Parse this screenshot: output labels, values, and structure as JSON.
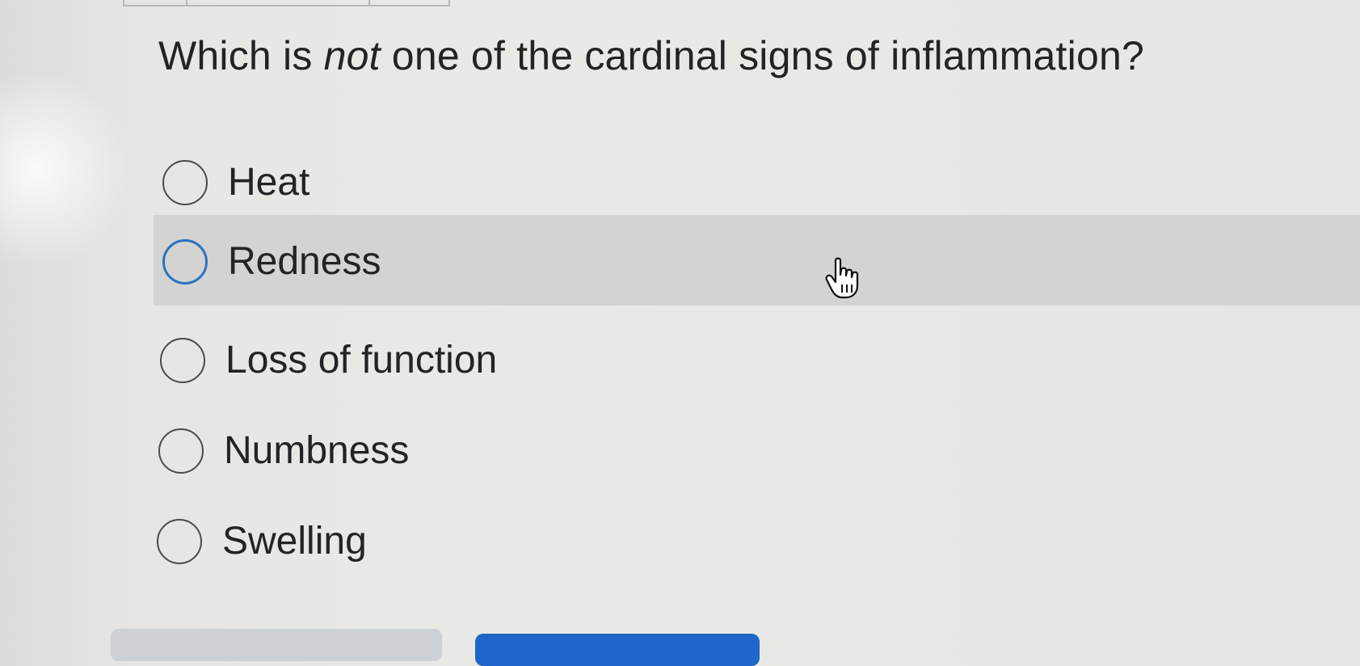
{
  "question": {
    "prefix": "Which is ",
    "emphasis": "not",
    "suffix": " one of the cardinal signs of inflammation?"
  },
  "options": [
    {
      "label": "Heat",
      "hovered": false
    },
    {
      "label": "Redness",
      "hovered": true
    },
    {
      "label": "Loss of function",
      "hovered": false
    },
    {
      "label": "Numbness",
      "hovered": false
    },
    {
      "label": "Swelling",
      "hovered": false
    }
  ],
  "cursor": {
    "icon": "pointer-hand-icon"
  },
  "colors": {
    "hover_row": "#d3d3d1",
    "radio_focus": "#2b72c2",
    "primary_button": "#1e66c9",
    "secondary_button": "#cdd0d4"
  }
}
